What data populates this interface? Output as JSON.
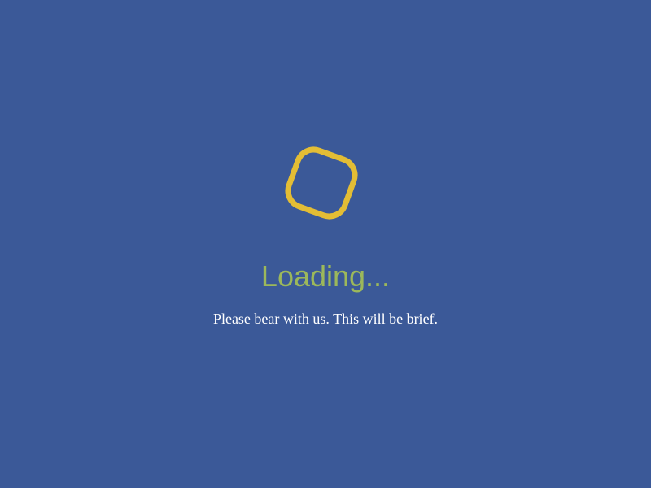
{
  "loading": {
    "title": "Loading...",
    "subtitle": "Please bear with us. This will be brief.",
    "spinner_icon": "rounded-square-spinner-icon"
  },
  "colors": {
    "background": "#3b5998",
    "spinner": "#e3bd35",
    "title": "#9cb85b",
    "subtitle": "#ffffff"
  }
}
